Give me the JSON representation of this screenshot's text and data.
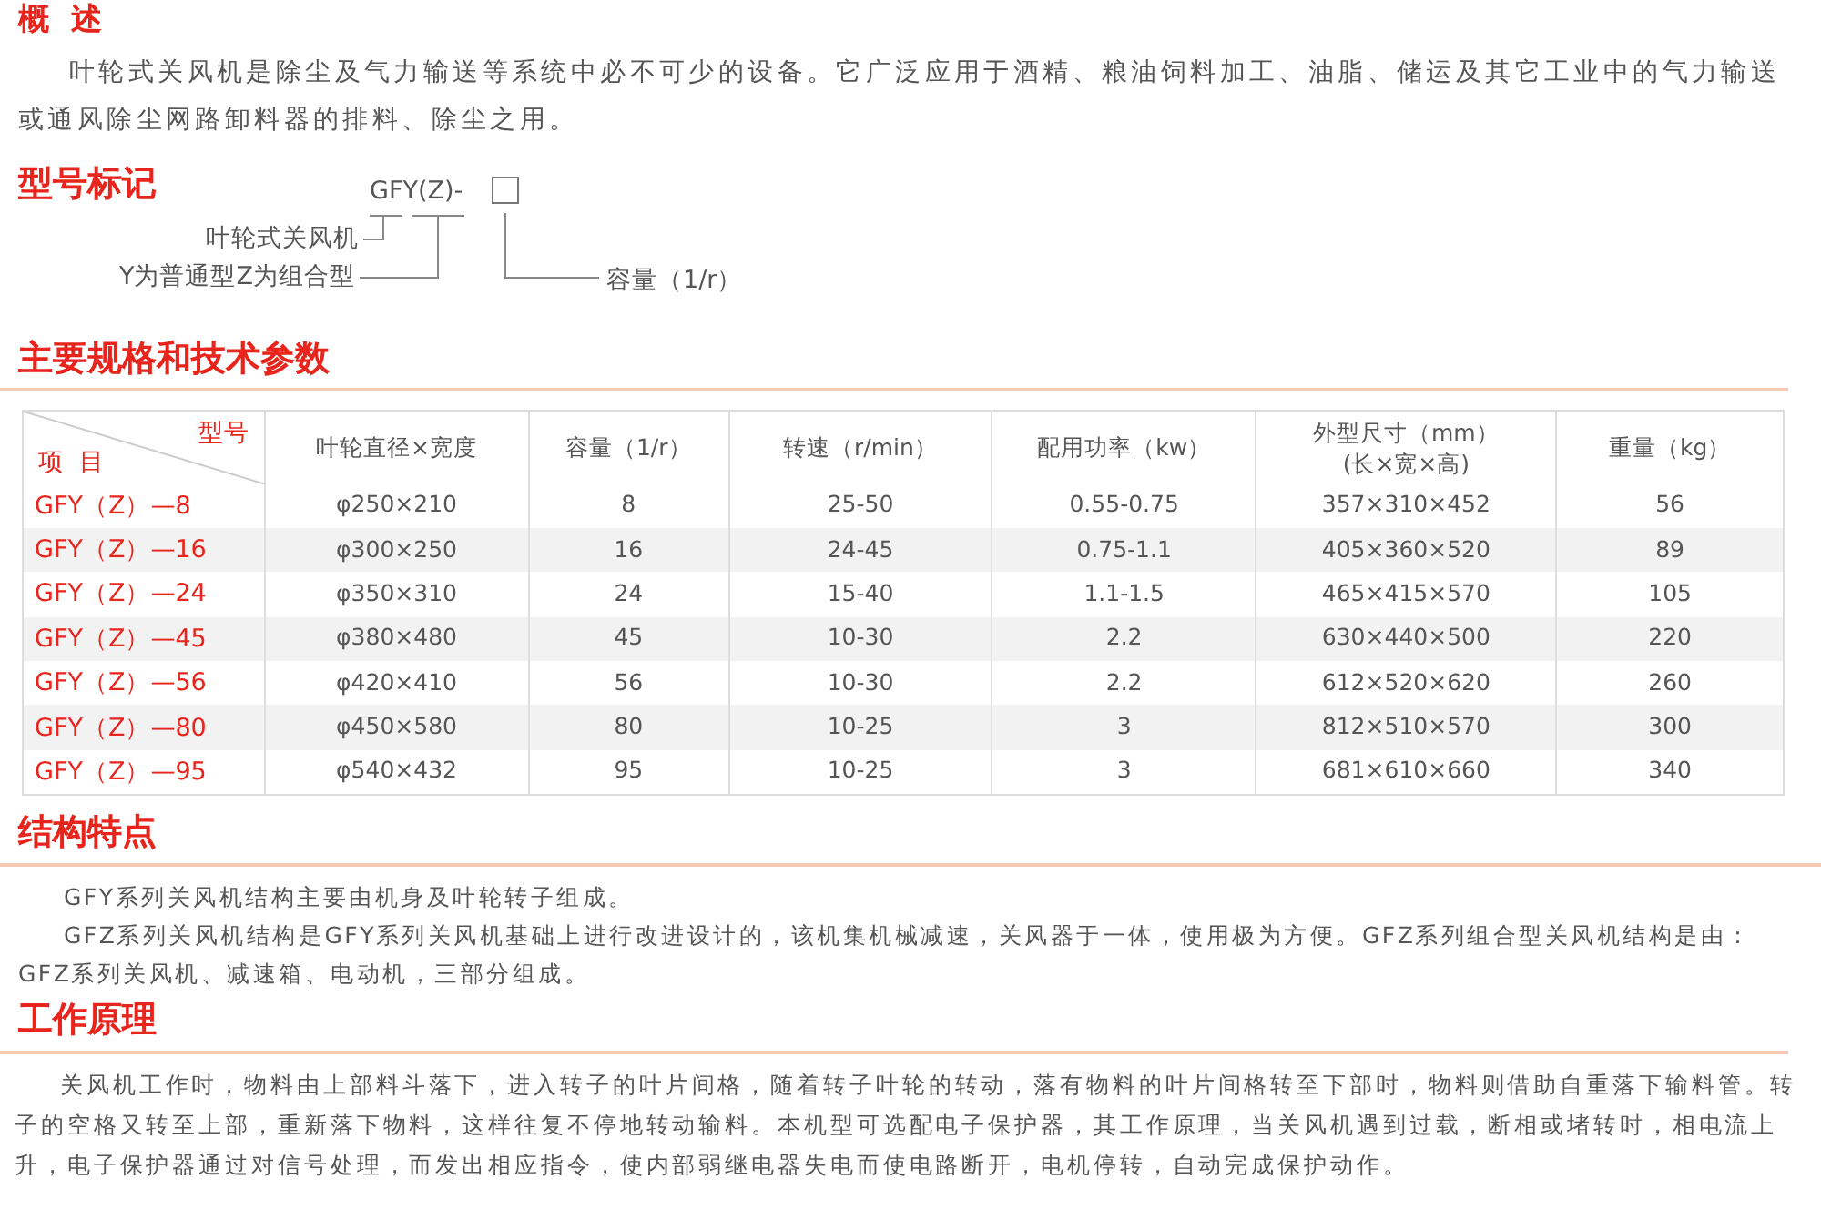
{
  "overview": {
    "heading": "概  述",
    "paragraph": "叶轮式关风机是除尘及气力输送等系统中必不可少的设备。它广泛应用于酒精、粮油饲料加工、油脂、储运及其它工业中的气力输送或通风除尘网路卸料器的排料、除尘之用。"
  },
  "model_marking": {
    "heading": "型号标记",
    "code": "GFY(Z)-",
    "labels": [
      "叶轮式关风机",
      "Y为普通型Z为组合型"
    ],
    "capacity_label": "容量（1/r）"
  },
  "specs": {
    "heading": "主要规格和技术参数",
    "columns": [
      [
        "型号",
        "项  目"
      ],
      "叶轮直径×宽度",
      "容量（1/r）",
      "转速（r/min）",
      "配用功率（kw）",
      "外型尺寸（mm）\n(长×宽×高)",
      "重量（kg）"
    ],
    "rows": [
      [
        "GFY（Z）—8",
        "φ250×210",
        "8",
        "25-50",
        "0.55-0.75",
        "357×310×452",
        "56"
      ],
      [
        "GFY（Z）—16",
        "φ300×250",
        "16",
        "24-45",
        "0.75-1.1",
        "405×360×520",
        "89"
      ],
      [
        "GFY（Z）—24",
        "φ350×310",
        "24",
        "15-40",
        "1.1-1.5",
        "465×415×570",
        "105"
      ],
      [
        "GFY（Z）—45",
        "φ380×480",
        "45",
        "10-30",
        "2.2",
        "630×440×500",
        "220"
      ],
      [
        "GFY（Z）—56",
        "φ420×410",
        "56",
        "10-30",
        "2.2",
        "612×520×620",
        "260"
      ],
      [
        "GFY（Z）—80",
        "φ450×580",
        "80",
        "10-25",
        "3",
        "812×510×570",
        "300"
      ],
      [
        "GFY（Z）—95",
        "φ540×432",
        "95",
        "10-25",
        "3",
        "681×610×660",
        "340"
      ]
    ]
  },
  "structure": {
    "heading": "结构特点",
    "paragraphs": [
      "GFY系列关风机结构主要由机身及叶轮转子组成。",
      "GFZ系列关风机结构是GFY系列关风机基础上进行改进设计的，该机集机械减速，关风器于一体，使用极为方便。GFZ系列组合型关风机结构是由：GFZ系列关风机、减速箱、电动机，三部分组成。"
    ]
  },
  "principle": {
    "heading": "工作原理",
    "paragraph": "关风机工作时，物料由上部料斗落下，进入转子的叶片间格，随着转子叶轮的转动，落有物料的叶片间格转至下部时，物料则借助自重落下输料管。转子的空格又转至上部，重新落下物料，这样往复不停地转动输料。本机型可选配电子保护器，其工作原理，当关风机遇到过载，断相或堵转时，相电流上升，电子保护器通过对信号处理，而发出相应指令，使内部弱继电器失电而使电路断开，电机停转，自动完成保护动作。"
  }
}
